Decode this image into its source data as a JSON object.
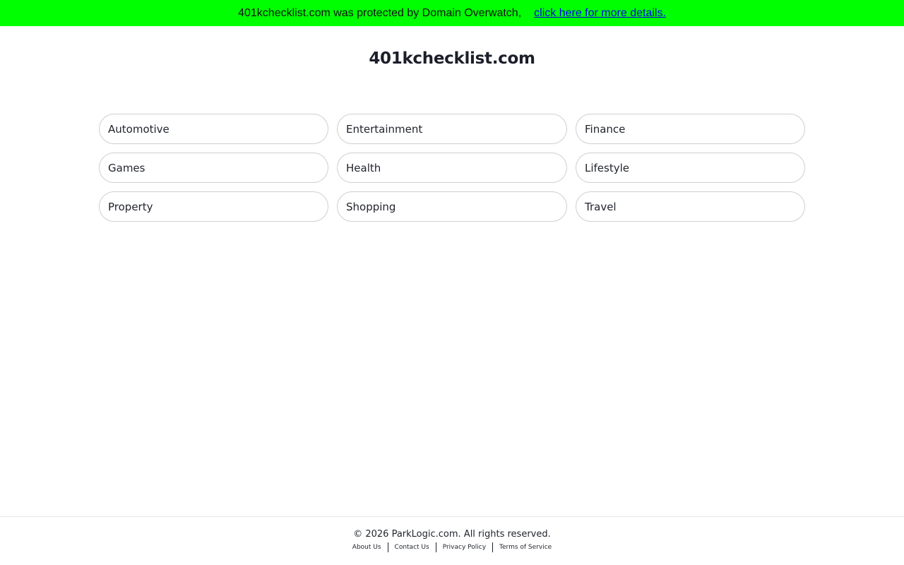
{
  "banner": {
    "message": "401kchecklist.com was protected by Domain Overwatch,",
    "link_text": "click here for more details.",
    "background": "#00ff00"
  },
  "site_title": "401kchecklist.com",
  "categories": [
    {
      "label": "Automotive"
    },
    {
      "label": "Entertainment"
    },
    {
      "label": "Finance"
    },
    {
      "label": "Games"
    },
    {
      "label": "Health"
    },
    {
      "label": "Lifestyle"
    },
    {
      "label": "Property"
    },
    {
      "label": "Shopping"
    },
    {
      "label": "Travel"
    }
  ],
  "footer": {
    "copyright": "© 2026 ParkLogic.com. All rights reserved.",
    "links": [
      {
        "label": "About Us"
      },
      {
        "label": "Contact Us"
      },
      {
        "label": "Privacy Policy"
      },
      {
        "label": "Terms of Service"
      }
    ]
  }
}
